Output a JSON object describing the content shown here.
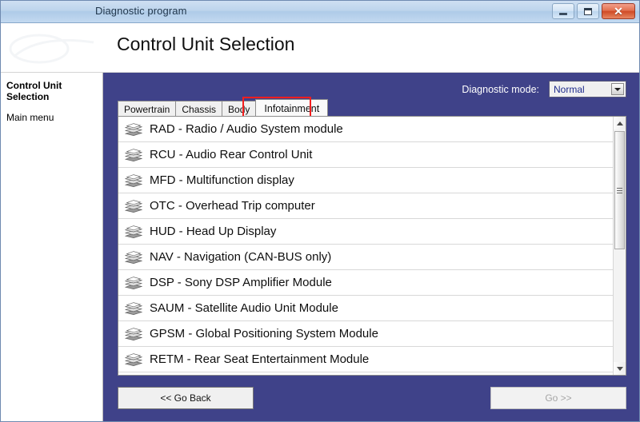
{
  "window": {
    "title": "Diagnostic program",
    "minimize_label": "Minimize",
    "maximize_label": "Maximize",
    "close_label": "Close",
    "close_glyph": "✕"
  },
  "header": {
    "page_title": "Control Unit Selection"
  },
  "sidebar": {
    "heading": "Control Unit Selection",
    "items": [
      {
        "label": "Main menu"
      }
    ]
  },
  "mode": {
    "label": "Diagnostic mode:",
    "value": "Normal",
    "options": [
      "Normal"
    ]
  },
  "tabs": [
    {
      "label": "Powertrain",
      "active": false
    },
    {
      "label": "Chassis",
      "active": false
    },
    {
      "label": "Body",
      "active": false
    },
    {
      "label": "Infotainment",
      "active": true
    }
  ],
  "list": {
    "icon_name": "module-icon",
    "rows": [
      {
        "label": "RAD - Radio / Audio System module"
      },
      {
        "label": "RCU - Audio Rear Control Unit"
      },
      {
        "label": "MFD - Multifunction display"
      },
      {
        "label": "OTC - Overhead Trip computer"
      },
      {
        "label": "HUD - Head Up Display"
      },
      {
        "label": "NAV - Navigation (CAN-BUS only)"
      },
      {
        "label": "DSP - Sony DSP Amplifier Module"
      },
      {
        "label": "SAUM - Satellite Audio Unit Module"
      },
      {
        "label": "GPSM - Global Positioning System Module"
      },
      {
        "label": "RETM - Rear Seat Entertainment Module"
      }
    ]
  },
  "scrollbar": {
    "up_label": "Scroll up",
    "down_label": "Scroll down"
  },
  "footer": {
    "back_label": "<< Go Back",
    "go_label": "Go >>",
    "go_disabled": true
  },
  "colors": {
    "content_blue": "#3f4289",
    "highlight_red": "#f41e1e",
    "select_text_blue": "#1e2b8c",
    "titlebar_blue": "#bdd4ec",
    "close_red": "#cf4a26"
  }
}
